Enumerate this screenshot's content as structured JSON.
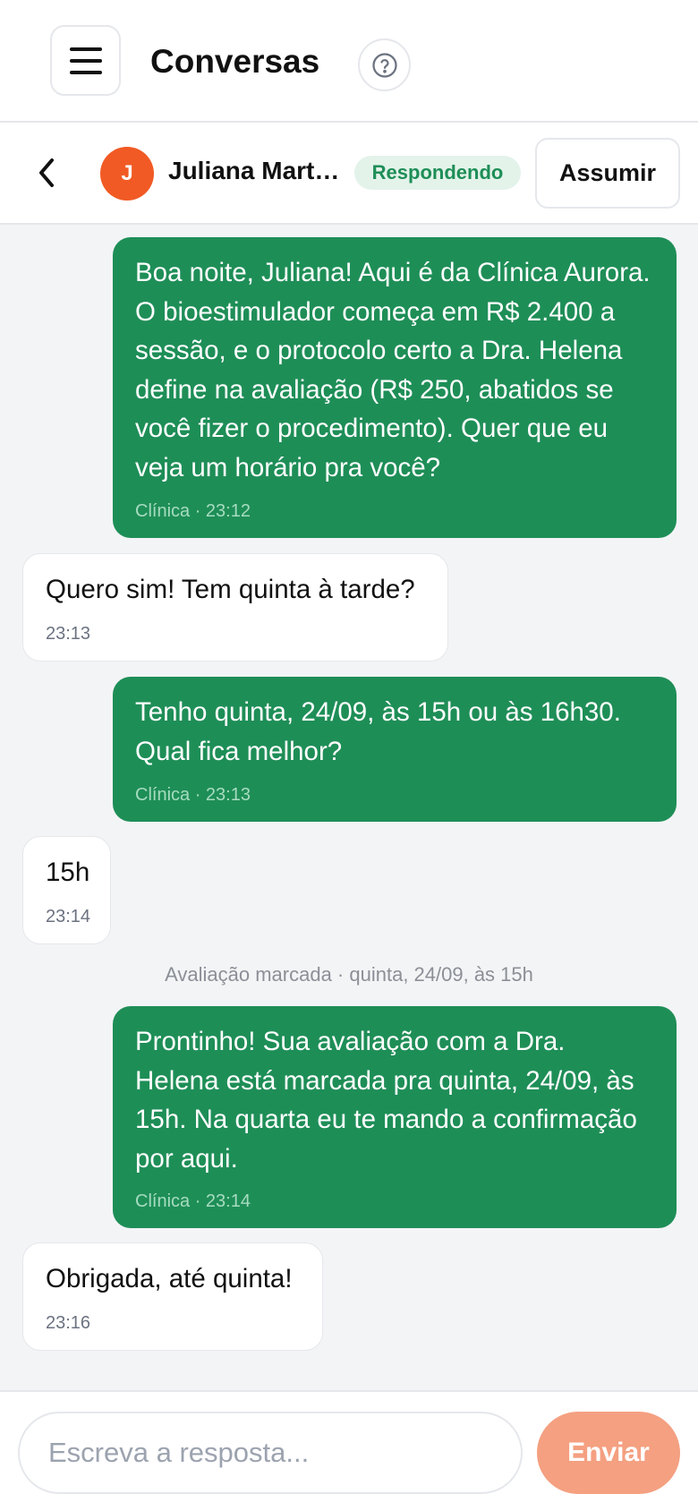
{
  "header": {
    "title": "Conversas",
    "menu_icon": "hamburger-menu-icon",
    "help_icon": "help-circle-icon"
  },
  "conversation": {
    "back_icon": "chevron-left-icon",
    "contact_initial": "J",
    "contact_name": "Juliana Martins",
    "status": "Respondendo",
    "assume_label": "Assumir"
  },
  "messages": [
    {
      "from": "clinic",
      "text": "Boa noite, Juliana! Aqui é da Clínica Aurora. O bioestimulador começa em R$ 2.400 a sessão, e o protocolo certo a Dra. Helena define na avaliação (R$ 250, abatidos se você fizer o procedimento). Quer que eu veja um horário pra você?",
      "meta": "Clínica · 23:12"
    },
    {
      "from": "contact",
      "text": "Quero sim! Tem quinta à tarde?",
      "meta": "23:13"
    },
    {
      "from": "clinic",
      "text": "Tenho quinta, 24/09, às 15h ou às 16h30. Qual fica melhor?",
      "meta": "Clínica · 23:13"
    },
    {
      "from": "contact",
      "text": "15h",
      "meta": "23:14"
    },
    {
      "from": "clinic",
      "text": "Prontinho! Sua avaliação com a Dra. Helena está marcada pra quinta, 24/09, às 15h. Na quarta eu te mando a confirmação por aqui.",
      "meta": "Clínica · 23:14"
    },
    {
      "from": "contact",
      "text": "Obrigada, até quinta!",
      "meta": "23:16"
    }
  ],
  "system_note": "Avaliação marcada · quinta, 24/09, às 15h",
  "composer": {
    "placeholder": "Escreva a resposta...",
    "value": "",
    "send_label": "Enviar"
  },
  "colors": {
    "clinic_bubble": "#1e8e57",
    "avatar": "#f15a24",
    "send_button": "#f4a081",
    "status_badge_bg": "#e3f3ea"
  }
}
